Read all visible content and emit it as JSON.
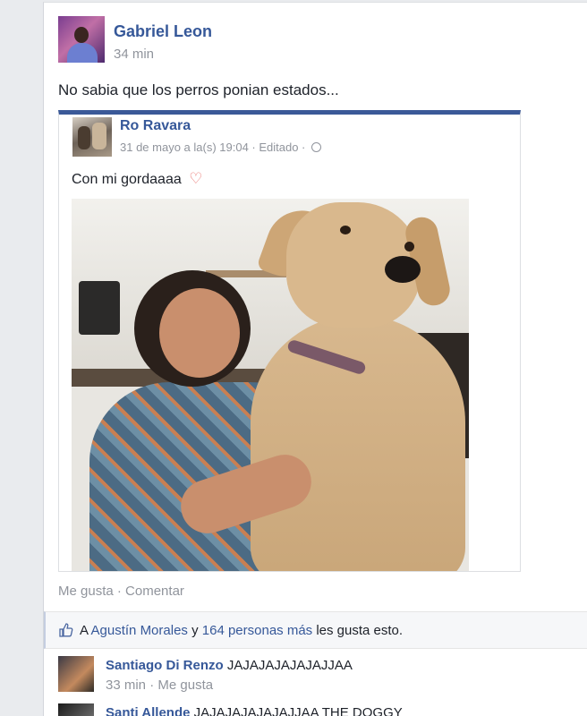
{
  "post": {
    "author": "Gabriel Leon",
    "time": "34 min",
    "text": "No sabia que los perros ponian estados..."
  },
  "shared": {
    "author": "Ro Ravara",
    "meta": "31 de mayo a la(s) 19:04 · Editado ·",
    "text": "Con mi gordaaaa",
    "accent_color": "#3b5998"
  },
  "actions": {
    "like": "Me gusta",
    "separator": "·",
    "comment": "Comentar"
  },
  "likes": {
    "prefix": "A",
    "person": "Agustín Morales",
    "and": "y",
    "others": "164 personas más",
    "suffix": "les gusta esto."
  },
  "comments": [
    {
      "name": "Santiago Di Renzo",
      "text": "JAJAJAJAJAJAJJAA",
      "time": "33 min",
      "like": "Me gusta"
    },
    {
      "name": "Santi Allende",
      "text": "JAJAJAJAJAJAJJAA THE DOGGY"
    }
  ],
  "colors": {
    "link": "#365899",
    "meta": "#90949c",
    "background": "#e9ebee"
  }
}
